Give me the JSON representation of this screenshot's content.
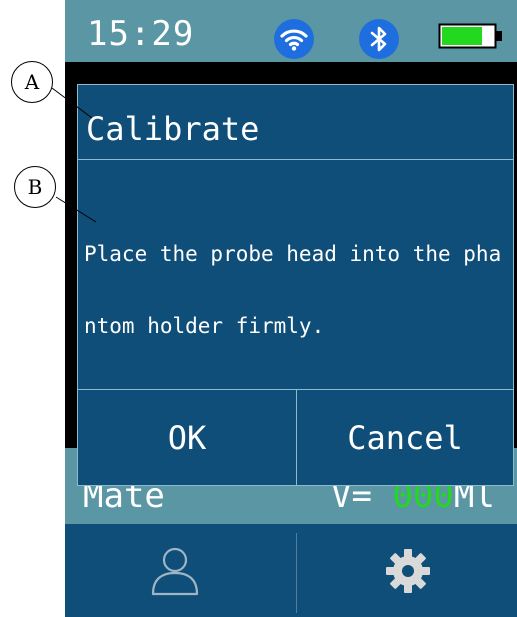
{
  "status_bar": {
    "time": "15:29",
    "wifi_icon": "wifi-icon",
    "bluetooth_icon": "bluetooth-icon",
    "battery_icon": "battery-icon",
    "battery_color": "#23d81f"
  },
  "background_row": {
    "left_text": "Mate",
    "right_prefix": "V=",
    "right_value": "000",
    "right_suffix": "Ml"
  },
  "tab_bar": {
    "left_icon": "user-icon",
    "right_icon": "gear-icon"
  },
  "dialog": {
    "title": "Calibrate",
    "message": "Place the probe head into the phantom holder firmly.",
    "ok_label": "OK",
    "cancel_label": "Cancel"
  },
  "annotations": {
    "a_label": "A",
    "b_label": "B"
  },
  "colors": {
    "screen_bg": "#0f4e78",
    "status_bar_bg": "#5a96a3",
    "icon_blue": "#1f6ee0",
    "value_green": "#23d81f"
  }
}
